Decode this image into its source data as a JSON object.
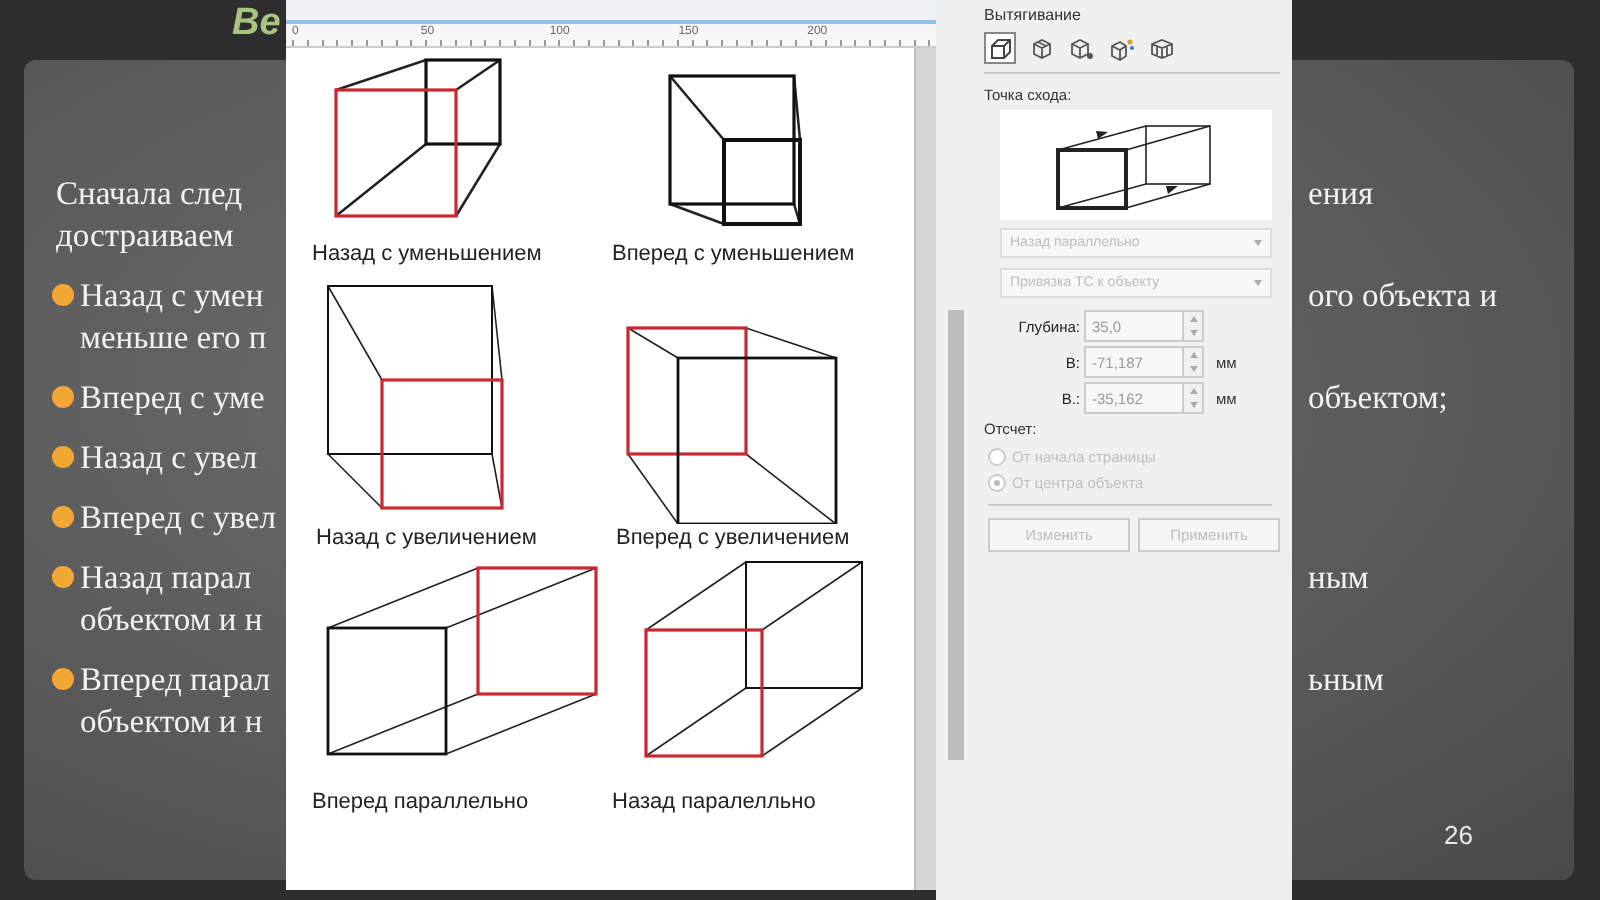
{
  "slide": {
    "title_fragment": "Ве",
    "paragraphs": [
      {
        "bullet": false,
        "lines": [
          {
            "left": "Сначала след",
            "right": "ения"
          },
          {
            "left": "достраиваем"
          }
        ]
      },
      {
        "bullet": true,
        "lines": [
          {
            "left": "Назад с умен",
            "right": "ого объекта и"
          },
          {
            "left": "меньше его п"
          }
        ]
      },
      {
        "bullet": true,
        "lines": [
          {
            "left": "Вперед с уме",
            "right": "объектом;"
          }
        ]
      },
      {
        "bullet": true,
        "lines": [
          {
            "left": "Назад с увел"
          }
        ]
      },
      {
        "bullet": true,
        "lines": [
          {
            "left": "Вперед с увел"
          }
        ]
      },
      {
        "bullet": true,
        "lines": [
          {
            "left": "Назад парал",
            "right": "ным"
          },
          {
            "left": "объектом и н"
          }
        ]
      },
      {
        "bullet": true,
        "lines": [
          {
            "left": "Вперед парал",
            "right": "ьным"
          },
          {
            "left": "объектом и н"
          }
        ]
      }
    ],
    "page_number": "26"
  },
  "canvas": {
    "ruler_labels": [
      "0",
      "50",
      "100",
      "150",
      "200"
    ],
    "figures": [
      {
        "caption": "Назад с уменьшением"
      },
      {
        "caption": "Вперед с уменьшением"
      },
      {
        "caption": "Назад с увеличением"
      },
      {
        "caption": "Вперед с увеличением"
      },
      {
        "caption": "Вперед параллельно"
      },
      {
        "caption": "Назад паралелльно"
      }
    ]
  },
  "extrude_panel": {
    "title": "Вытягивание",
    "types": [
      {
        "selected": true
      },
      {
        "selected": false
      },
      {
        "selected": false
      },
      {
        "selected": false
      },
      {
        "selected": false
      }
    ],
    "vanishing_point_label": "Точка схода:",
    "dropdowns": [
      {
        "value": "Назад параллельно",
        "disabled": true
      },
      {
        "value": "Привязка ТС к объекту",
        "disabled": true
      }
    ],
    "fields": [
      {
        "label": "Глубина:",
        "value": "35,0",
        "disabled": true
      },
      {
        "label": "В:",
        "value": "-71,187",
        "unit": "мм",
        "disabled": true
      },
      {
        "label": "В.:",
        "value": "-35,162",
        "unit": "мм",
        "disabled": true
      }
    ],
    "origin_label": "Отсчет:",
    "origin_options": [
      {
        "label": "От начала страницы",
        "selected": false,
        "disabled": true
      },
      {
        "label": "От центра объекта",
        "selected": true,
        "disabled": true
      }
    ],
    "buttons": [
      {
        "label": "Изменить",
        "disabled": true
      },
      {
        "label": "Применить",
        "disabled": true
      }
    ]
  }
}
